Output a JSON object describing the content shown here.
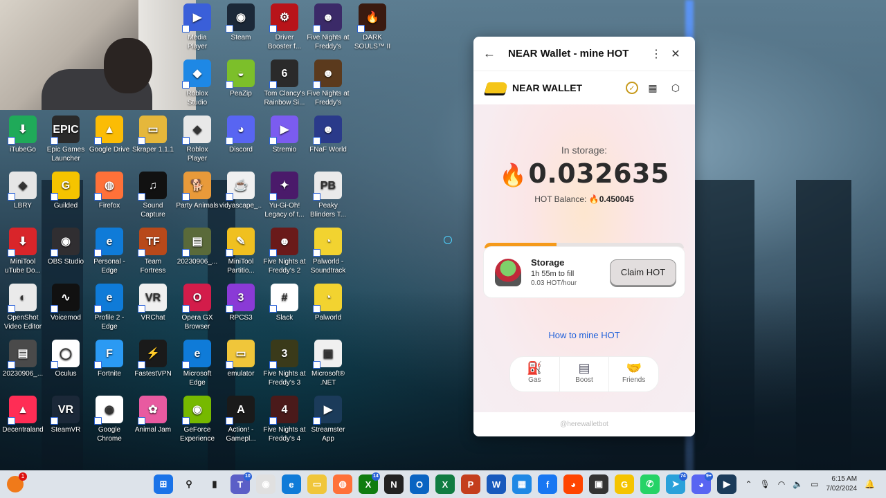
{
  "desktop": {
    "icons": [
      {
        "label": "Media\nPlayer",
        "color": "#3a5fd9",
        "glyph": "▶"
      },
      {
        "label": "Steam",
        "color": "#1b2838",
        "glyph": "◉"
      },
      {
        "label": "Driver\nBooster f...",
        "color": "#b8141a",
        "glyph": "⚙"
      },
      {
        "label": "Five Nights at\nFreddy's Sist...",
        "color": "#3b2a68",
        "glyph": "☻"
      },
      {
        "label": "DARK\nSOULS™ II",
        "color": "#3a1a10",
        "glyph": "🔥"
      },
      {
        "label": "Roblox\nStudio",
        "color": "#1e88e5",
        "glyph": "◆"
      },
      {
        "label": "PeaZip",
        "color": "#7cbf2a",
        "glyph": "◒"
      },
      {
        "label": "Tom Clancy's\nRainbow Si...",
        "color": "#2a2a2a",
        "glyph": "6"
      },
      {
        "label": "Five Nights at\nFreddy's",
        "color": "#5b3a1d",
        "glyph": "☻"
      },
      {
        "label": "iTubeGo",
        "color": "#1faa59",
        "glyph": "⬇"
      },
      {
        "label": "Epic Games\nLauncher",
        "color": "#2a2a2a",
        "glyph": "EPIC"
      },
      {
        "label": "Google Drive",
        "color": "#fbbc05",
        "glyph": "▲"
      },
      {
        "label": "Skraper 1.1.1",
        "color": "#e5b73b",
        "glyph": "▭"
      },
      {
        "label": "Roblox Player",
        "color": "#e8e8e8",
        "glyph": "◆"
      },
      {
        "label": "Discord",
        "color": "#5865f2",
        "glyph": "◕"
      },
      {
        "label": "Stremio",
        "color": "#7b5cf0",
        "glyph": "▶"
      },
      {
        "label": "FNaF World",
        "color": "#2a3a8a",
        "glyph": "☻"
      },
      {
        "label": "LBRY",
        "color": "#e6e6e6",
        "glyph": "◈"
      },
      {
        "label": "Guilded",
        "color": "#f5c400",
        "glyph": "G"
      },
      {
        "label": "Firefox",
        "color": "#ff7139",
        "glyph": "◍"
      },
      {
        "label": "Sound\nCapture",
        "color": "#111111",
        "glyph": "♫"
      },
      {
        "label": "Party Animals",
        "color": "#e89a3a",
        "glyph": "🐕"
      },
      {
        "label": "vidyascape_...",
        "color": "#f0f0f0",
        "glyph": "☕"
      },
      {
        "label": "Yu-Gi-Oh!\nLegacy of t...",
        "color": "#4a1a6a",
        "glyph": "✦"
      },
      {
        "label": "Peaky\nBlinders T...",
        "color": "#eaeaea",
        "glyph": "PB"
      },
      {
        "label": "MiniTool\nuTube Do...",
        "color": "#d9252a",
        "glyph": "⬇"
      },
      {
        "label": "OBS Studio",
        "color": "#302e31",
        "glyph": "◉"
      },
      {
        "label": "Personal -\nEdge",
        "color": "#0f7bd8",
        "glyph": "e"
      },
      {
        "label": "Team Fortress\n2",
        "color": "#b8491a",
        "glyph": "TF"
      },
      {
        "label": "20230906_...",
        "color": "#5a6a3a",
        "glyph": "▤"
      },
      {
        "label": "MiniTool\nPartitio...",
        "color": "#f0c020",
        "glyph": "✎"
      },
      {
        "label": "Five Nights at\nFreddy's 2",
        "color": "#6a1a1a",
        "glyph": "☻"
      },
      {
        "label": "Palworld -\nSoundtrack",
        "color": "#f2d330",
        "glyph": "◔"
      },
      {
        "label": "OpenShot\nVideo Editor",
        "color": "#eaeaea",
        "glyph": "◐"
      },
      {
        "label": "Voicemod",
        "color": "#111111",
        "glyph": "∿"
      },
      {
        "label": "Profile 2 -\nEdge",
        "color": "#0f7bd8",
        "glyph": "e"
      },
      {
        "label": "VRChat",
        "color": "#f0f0f0",
        "glyph": "VR"
      },
      {
        "label": "Opera GX\nBrowser",
        "color": "#d31c4a",
        "glyph": "O"
      },
      {
        "label": "RPCS3",
        "color": "#8a3ad6",
        "glyph": "3"
      },
      {
        "label": "Slack",
        "color": "#ffffff",
        "glyph": "#"
      },
      {
        "label": "Palworld",
        "color": "#f2d330",
        "glyph": "◔"
      },
      {
        "label": "20230906_...",
        "color": "#4a4a4a",
        "glyph": "▤"
      },
      {
        "label": "Oculus",
        "color": "#ffffff",
        "glyph": "◯"
      },
      {
        "label": "Fortnite",
        "color": "#2b9af3",
        "glyph": "F"
      },
      {
        "label": "FastestVPN",
        "color": "#1a1a1a",
        "glyph": "⚡"
      },
      {
        "label": "Microsoft\nEdge",
        "color": "#0f7bd8",
        "glyph": "e"
      },
      {
        "label": "emulator",
        "color": "#f0c63a",
        "glyph": "▭"
      },
      {
        "label": "Five Nights at\nFreddy's 3",
        "color": "#3a3a1a",
        "glyph": "3"
      },
      {
        "label": "Microsoft®\n.NET",
        "color": "#f0f0f0",
        "glyph": "▣"
      },
      {
        "label": "Decentraland",
        "color": "#ff2d55",
        "glyph": "▲"
      },
      {
        "label": "SteamVR",
        "color": "#1b2838",
        "glyph": "VR"
      },
      {
        "label": "Google\nChrome",
        "color": "#ffffff",
        "glyph": "◉"
      },
      {
        "label": "Animal Jam",
        "color": "#e85aa0",
        "glyph": "✿"
      },
      {
        "label": "GeForce\nExperience",
        "color": "#76b900",
        "glyph": "◉"
      },
      {
        "label": "Action! -\nGamepl...",
        "color": "#1a1a1a",
        "glyph": "A"
      },
      {
        "label": "Five Nights at\nFreddy's 4",
        "color": "#4a1a1a",
        "glyph": "4"
      },
      {
        "label": "Streamster\nApp",
        "color": "#1b3b5a",
        "glyph": "▶"
      }
    ]
  },
  "wallet": {
    "window_title": "NEAR Wallet - mine HOT",
    "app_name": "NEAR WALLET",
    "storage_label": "In storage:",
    "storage_amount": "0.032635",
    "hot_balance_label": "HOT Balance:",
    "hot_balance_value": "0.450045",
    "progress_fraction": 0.36,
    "storage_card": {
      "title": "Storage",
      "time_to_fill": "1h 55m to fill",
      "rate": "0.03 HOT/hour",
      "claim_button": "Claim HOT"
    },
    "how_to_link": "How to mine HOT",
    "tabs": [
      {
        "label": "Gas",
        "icon": "gas-can-icon"
      },
      {
        "label": "Boost",
        "icon": "boost-icon"
      },
      {
        "label": "Friends",
        "icon": "friends-icon"
      }
    ],
    "footer": "@herewalletbot"
  },
  "taskbar": {
    "notification_badge": "1",
    "apps": [
      {
        "name": "windows-start-icon",
        "color": "#1a73e8",
        "glyph": "⊞"
      },
      {
        "name": "search-icon",
        "color": "transparent",
        "glyph": "⚲"
      },
      {
        "name": "task-view-icon",
        "color": "transparent",
        "glyph": "▮"
      },
      {
        "name": "teams-icon",
        "color": "#5b5fc7",
        "glyph": "T",
        "badge": "10"
      },
      {
        "name": "chrome-icon",
        "color": "#e0e0e0",
        "glyph": "◉"
      },
      {
        "name": "edge-icon",
        "color": "#0f7bd8",
        "glyph": "e"
      },
      {
        "name": "file-explorer-icon",
        "color": "#f0c63a",
        "glyph": "▭"
      },
      {
        "name": "firefox-icon",
        "color": "#ff7139",
        "glyph": "◍"
      },
      {
        "name": "xbox-icon",
        "color": "#107c10",
        "glyph": "X",
        "badge": "14"
      },
      {
        "name": "notion-icon",
        "color": "#222222",
        "glyph": "N"
      },
      {
        "name": "outlook-icon",
        "color": "#0a64c2",
        "glyph": "O"
      },
      {
        "name": "excel-icon",
        "color": "#107c41",
        "glyph": "X"
      },
      {
        "name": "powerpoint-icon",
        "color": "#c43e1c",
        "glyph": "P"
      },
      {
        "name": "word-icon",
        "color": "#185abd",
        "glyph": "W"
      },
      {
        "name": "calculator-icon",
        "color": "#1e88e5",
        "glyph": "▦"
      },
      {
        "name": "facebook-icon",
        "color": "#1877f2",
        "glyph": "f"
      },
      {
        "name": "reddit-icon",
        "color": "#ff4500",
        "glyph": "◕"
      },
      {
        "name": "store-icon",
        "color": "#333333",
        "glyph": "▣"
      },
      {
        "name": "guilded-icon",
        "color": "#f5c400",
        "glyph": "G"
      },
      {
        "name": "whatsapp-icon",
        "color": "#25d366",
        "glyph": "✆"
      },
      {
        "name": "telegram-icon",
        "color": "#2aa1da",
        "glyph": "➤",
        "badge": "74"
      },
      {
        "name": "discord-icon",
        "color": "#5865f2",
        "glyph": "◕",
        "badge": "9+"
      },
      {
        "name": "streamster-icon",
        "color": "#1b3b5a",
        "glyph": "▶"
      }
    ],
    "time": "6:15 AM",
    "date": "7/02/2024"
  }
}
